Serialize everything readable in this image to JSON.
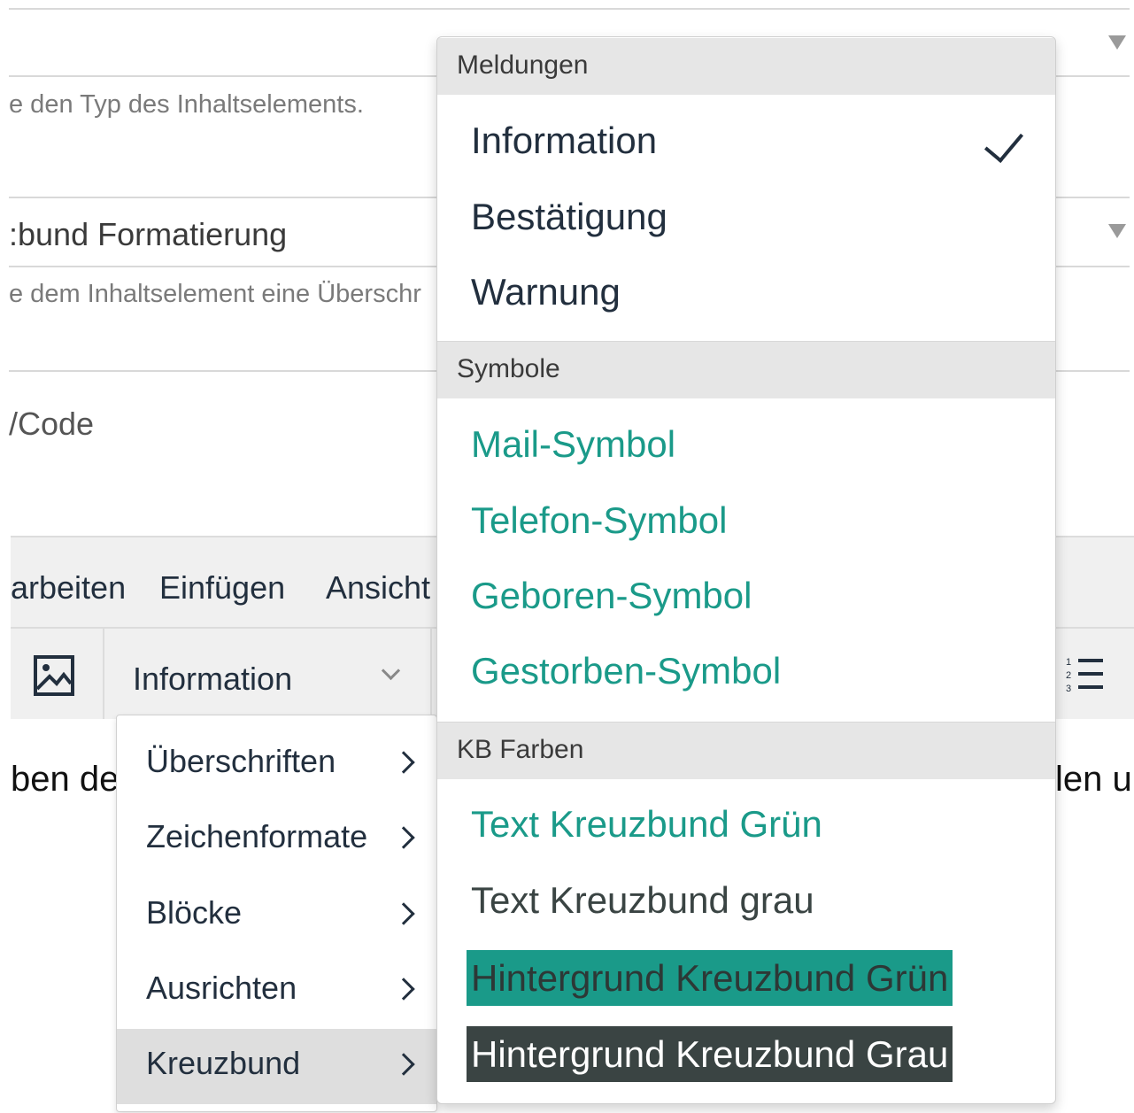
{
  "form": {
    "type_help": "e den Typ des Inhaltselements.",
    "header_layout_value": ":bund Formatierung",
    "header_help": "e dem Inhaltselement eine Überschr",
    "code_label": "/Code"
  },
  "editor": {
    "menubar": [
      "arbeiten",
      "Einfügen",
      "Ansicht"
    ],
    "format_select_value": "Information",
    "content_left": "ben de",
    "content_right": "len u"
  },
  "submenu": {
    "items": [
      {
        "label": "Überschriften"
      },
      {
        "label": "Zeichenformate"
      },
      {
        "label": "Blöcke"
      },
      {
        "label": "Ausrichten"
      },
      {
        "label": "Kreuzbund",
        "active": true
      }
    ]
  },
  "dropdown": {
    "groups": [
      {
        "title": "Meldungen",
        "items": [
          "Information",
          "Bestätigung",
          "Warnung"
        ],
        "checked": "Information"
      },
      {
        "title": "Symbole",
        "items": [
          "Mail-Symbol",
          "Telefon-Symbol",
          "Geboren-Symbol",
          "Gestorben-Symbol"
        ]
      },
      {
        "title": "KB Farben",
        "items": [
          "Text Kreuzbund Grün",
          "Text Kreuzbund grau",
          "Hintergrund Kreuzbund Grün",
          "Hintergrund Kreuzbund Grau"
        ]
      }
    ]
  },
  "colors": {
    "kreuzbund_green": "#1a9a89",
    "kreuzbund_gray": "#3a4443",
    "text_dark": "#222f3e"
  }
}
